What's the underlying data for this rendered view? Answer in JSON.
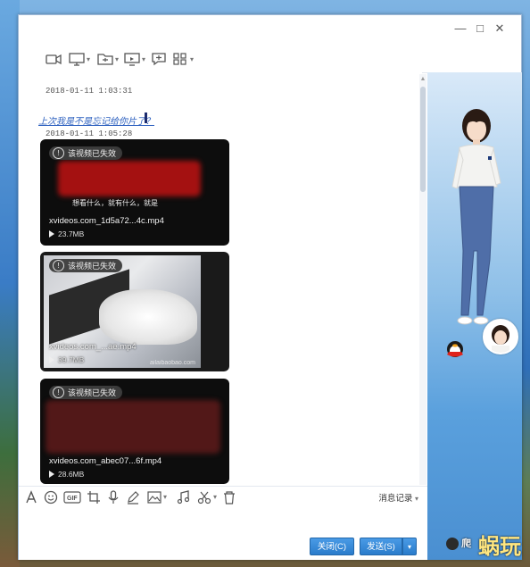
{
  "window": {
    "controls": {
      "minimize": "—",
      "maximize": "□",
      "close": "✕"
    }
  },
  "toolbar": {
    "icons": [
      "video-call-icon",
      "screen-share-icon",
      "send-file-icon",
      "remote-desktop-icon",
      "add-chat-icon",
      "apps-grid-icon"
    ]
  },
  "chat": {
    "timestamp_1": "2018-01-11 1:03:31",
    "quoted_message": "上次我是不是忘记给你片了？",
    "timestamp_2": "2018-01-11 1:05:28",
    "cards": [
      {
        "banner": "该视频已失效",
        "overlay_text": "想看什么，就有什么，就是",
        "filename": "xvideos.com_1d5a72...4c.mp4",
        "size": "23.7MB"
      },
      {
        "banner": "该视频已失效",
        "filename": "xvideos.com_...ae.mp4",
        "size": "39.7MB",
        "thumb_watermark": "ailaibaobao.com"
      },
      {
        "banner": "该视频已失效",
        "filename": "xvideos.com_abec07...6f.mp4",
        "size": "28.6MB"
      }
    ]
  },
  "input_toolbar": {
    "icons": [
      "font-icon",
      "emoji-icon",
      "gif-icon",
      "screenshot-icon",
      "voice-icon",
      "pen-icon",
      "image-icon",
      "music-icon",
      "scissors-icon",
      "trash-icon"
    ],
    "history_label": "消息记录"
  },
  "send_bar": {
    "close_label": "关闭(C)",
    "send_label": "发送(S)"
  },
  "watermarks": {
    "app": "爬",
    "brand": "蜗玩"
  },
  "colors": {
    "accent": "#2a7ccb",
    "link": "#2b5fbf",
    "card_bg": "#0d0d0d"
  }
}
